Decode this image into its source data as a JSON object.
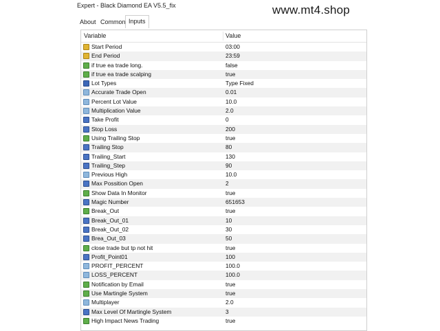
{
  "window": {
    "title": "Expert - Black Diamond EA V5.5_fix"
  },
  "watermark": "www.mt4.shop",
  "tabs": [
    {
      "label": "About"
    },
    {
      "label": "Common"
    },
    {
      "label": "Inputs"
    }
  ],
  "table": {
    "headers": {
      "variable": "Variable",
      "value": "Value"
    },
    "rows": [
      {
        "name": "Start Period",
        "value": "03:00",
        "icon": "clock-icon"
      },
      {
        "name": "End Period",
        "value": "23:59",
        "icon": "clock-icon"
      },
      {
        "name": "if true ea trade long.",
        "value": "false",
        "icon": "bool-icon"
      },
      {
        "name": "if true ea trade scalping",
        "value": "true",
        "icon": "bool-icon"
      },
      {
        "name": "Lot Types",
        "value": "Type Fixed",
        "icon": "list-icon"
      },
      {
        "name": "Accurate Trade Open",
        "value": "0.01",
        "icon": "double-icon"
      },
      {
        "name": "Percent Lot Value",
        "value": "10.0",
        "icon": "double-icon"
      },
      {
        "name": "Multiplication Value",
        "value": "2.0",
        "icon": "double-icon"
      },
      {
        "name": "Take Profit",
        "value": "0",
        "icon": "integer-icon"
      },
      {
        "name": "Stop Loss",
        "value": "200",
        "icon": "integer-icon"
      },
      {
        "name": "Using Trailing Stop",
        "value": "true",
        "icon": "bool-icon"
      },
      {
        "name": "Trailing Stop",
        "value": "80",
        "icon": "integer-icon"
      },
      {
        "name": "Trailing_Start",
        "value": "130",
        "icon": "integer-icon"
      },
      {
        "name": "Trailing_Step",
        "value": "90",
        "icon": "integer-icon"
      },
      {
        "name": "Previous High",
        "value": "10.0",
        "icon": "double-icon"
      },
      {
        "name": "Max Possition Open",
        "value": "2",
        "icon": "integer-icon"
      },
      {
        "name": "Show Data In Monitor",
        "value": "true",
        "icon": "bool-icon"
      },
      {
        "name": "Magic Number",
        "value": "651653",
        "icon": "integer-icon"
      },
      {
        "name": "Break_Out",
        "value": "true",
        "icon": "bool-icon"
      },
      {
        "name": "Break_Out_01",
        "value": "10",
        "icon": "integer-icon"
      },
      {
        "name": "Break_Out_02",
        "value": "30",
        "icon": "integer-icon"
      },
      {
        "name": "Brea_Out_03",
        "value": "50",
        "icon": "integer-icon"
      },
      {
        "name": "close trade but tp not hit",
        "value": "true",
        "icon": "bool-icon"
      },
      {
        "name": "Profit_Point01",
        "value": "100",
        "icon": "integer-icon"
      },
      {
        "name": "PROFIT_PERCENT",
        "value": "100.0",
        "icon": "double-icon"
      },
      {
        "name": "LOSS_PERCENT",
        "value": "100.0",
        "icon": "double-icon"
      },
      {
        "name": "Notification by Email",
        "value": "true",
        "icon": "bool-icon"
      },
      {
        "name": "Use Martingle System",
        "value": "true",
        "icon": "bool-icon"
      },
      {
        "name": "Multiplayer",
        "value": "2.0",
        "icon": "double-icon"
      },
      {
        "name": "Max Level Of Martingle System",
        "value": "3",
        "icon": "integer-icon"
      },
      {
        "name": "High Impact News Trading",
        "value": "true",
        "icon": "bool-icon"
      }
    ]
  },
  "colors": {
    "bool_icon": "#5fae4a",
    "integer_icon": "#4a74c4",
    "double_icon": "#8fb7dc",
    "clock_icon": "#e0b432",
    "list_icon": "#3d68b8",
    "alt_row": "#f1f1f1"
  }
}
